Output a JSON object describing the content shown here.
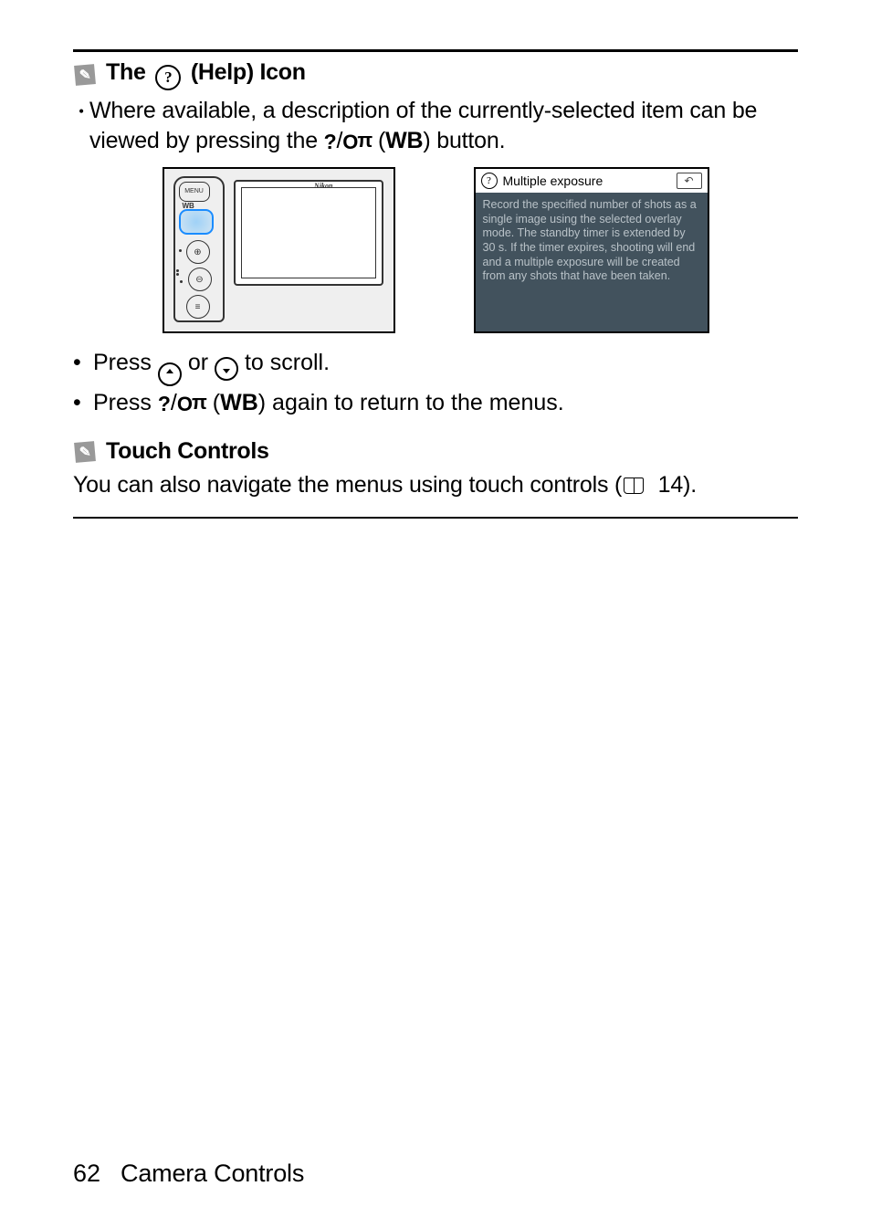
{
  "section1": {
    "title_pre": "The ",
    "title_post": " (Help) Icon",
    "para_a": "Where available, a description of the currently-selected item can be viewed by pressing the ",
    "para_b": " (",
    "para_c": ") button.",
    "wb": "WB"
  },
  "camera": {
    "brand": "Nikon",
    "menu_lbl": "MENU",
    "wb_lbl": "WB"
  },
  "help": {
    "title": "Multiple exposure",
    "body": "Record the specified number of shots as a single image using the selected overlay mode. The standby timer is extended by 30 s. If the timer expires, shooting will end and a multiple exposure will be created from any shots that have been taken."
  },
  "bullets": {
    "b1a": "Press ",
    "b1b": " or ",
    "b1c": " to scroll.",
    "b2a": "Press ",
    "b2b": " (",
    "b2c": ") again to return to the menus.",
    "wb": "WB"
  },
  "section2": {
    "title": "Touch Controls",
    "para_a": "You can also navigate the menus using touch controls (",
    "page_ref": "14",
    "para_b": ")."
  },
  "footer": {
    "page": "62",
    "chapter": "Camera Controls"
  }
}
